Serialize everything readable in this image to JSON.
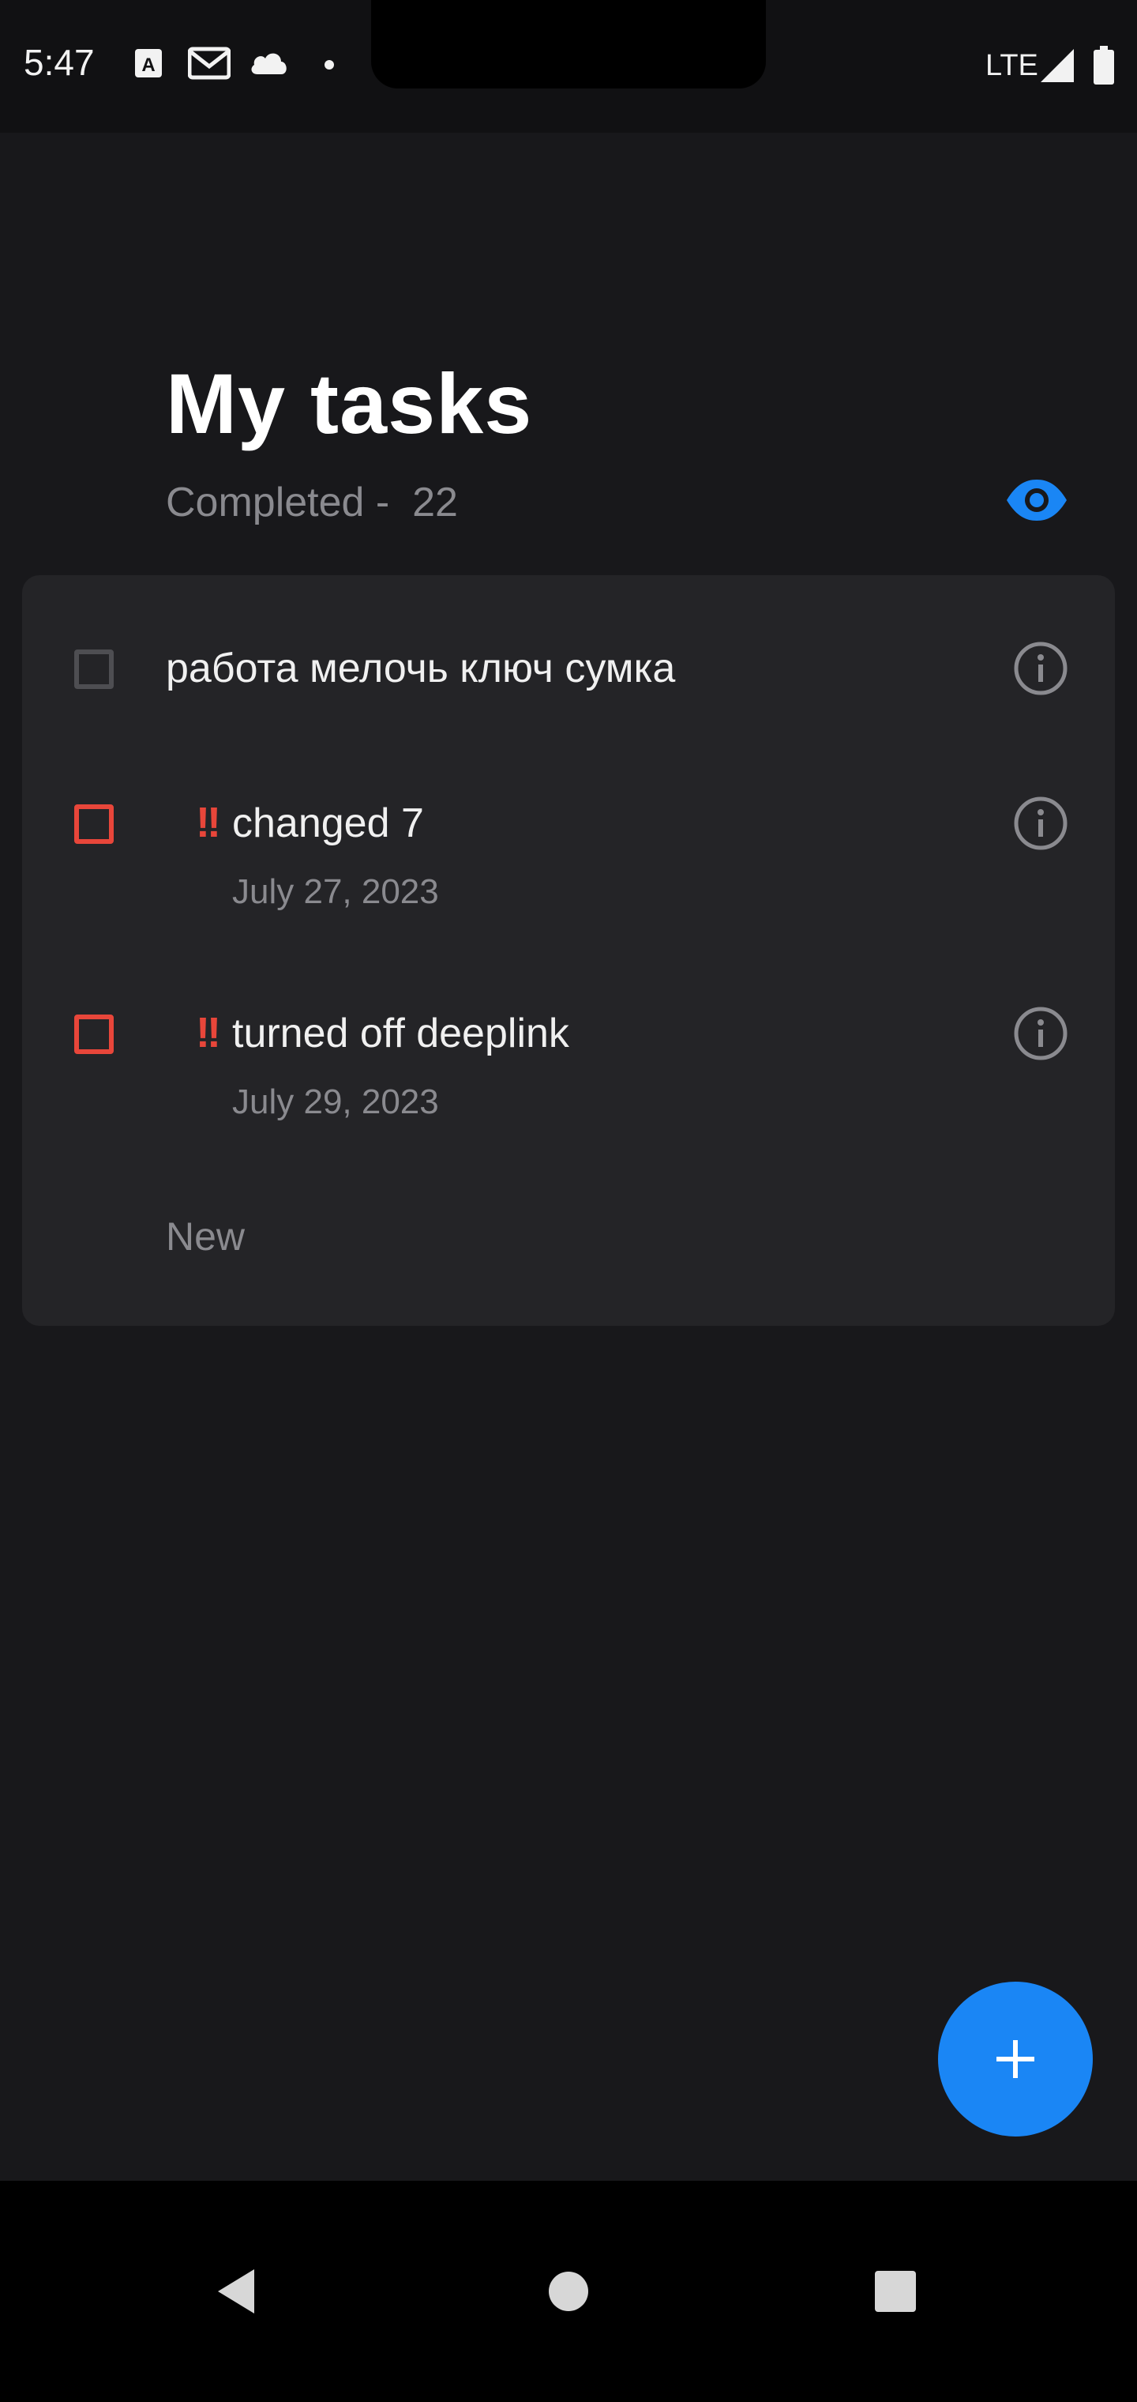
{
  "status_bar": {
    "time": "5:47",
    "network": "LTE",
    "icons": [
      "app-a-icon",
      "gmail-icon",
      "cloud-icon",
      "notification-dot-icon",
      "signal-icon",
      "battery-icon"
    ]
  },
  "header": {
    "title": "My tasks",
    "completed_label": "Completed - ",
    "completed_count": "22",
    "visibility_icon": "eye-icon"
  },
  "tasks": [
    {
      "title": "работа мелочь ключ сумка",
      "priority": "",
      "date": "",
      "checked": false
    },
    {
      "title": "changed 7",
      "priority": "!!",
      "date": "July 27, 2023",
      "checked": false
    },
    {
      "title": "turned off deeplink",
      "priority": "!!",
      "date": "July 29, 2023",
      "checked": false
    }
  ],
  "new_task_placeholder": "New",
  "colors": {
    "background": "#18181b",
    "card": "#242427",
    "accent": "#1a86f5",
    "priority_high": "#e8463a",
    "muted_text": "#8a8a8f"
  },
  "fab": {
    "icon": "plus-icon"
  },
  "nav_bar": {
    "icons": [
      "back-icon",
      "home-icon",
      "recents-icon"
    ]
  }
}
